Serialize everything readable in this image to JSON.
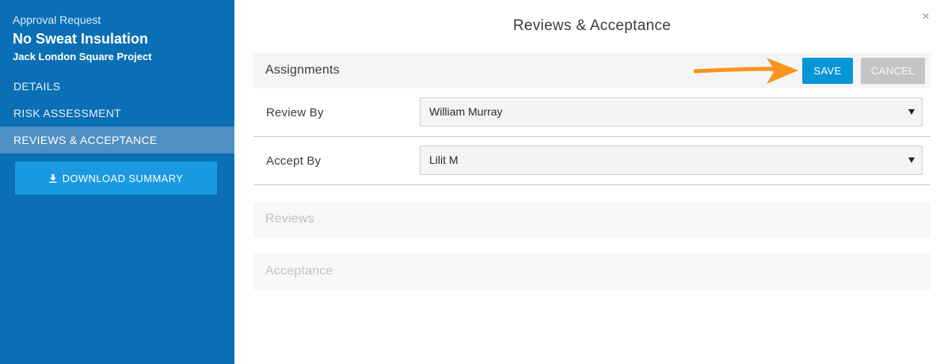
{
  "sidebar": {
    "label": "Approval Request",
    "title": "No Sweat Insulation",
    "subtitle": "Jack London Square Project",
    "nav": [
      {
        "label": "DETAILS"
      },
      {
        "label": "RISK ASSESSMENT"
      },
      {
        "label": "REVIEWS & ACCEPTANCE"
      }
    ],
    "active_nav": "REVIEWS & ACCEPTANCE",
    "download_label": "DOWNLOAD SUMMARY"
  },
  "main": {
    "title": "Reviews & Acceptance",
    "close_glyph": "×",
    "assignments": {
      "title": "Assignments",
      "save_label": "SAVE",
      "cancel_label": "CANCEL",
      "fields": [
        {
          "label": "Review By",
          "value": "William Murray"
        },
        {
          "label": "Accept By",
          "value": "Lilit M"
        }
      ]
    },
    "sections": [
      {
        "title": "Reviews"
      },
      {
        "title": "Acceptance"
      }
    ]
  },
  "colors": {
    "sidebar_bg": "#0a6fb5",
    "active_nav_bg": "#4f8fc4",
    "download_button": "#1a9ae1",
    "save_button": "#0696d7",
    "cancel_button": "#c4c4c4",
    "annotation_arrow": "#f7941d"
  },
  "icons": {
    "download": "download-icon",
    "close": "close-icon",
    "dropdown": "caret-down-icon"
  }
}
